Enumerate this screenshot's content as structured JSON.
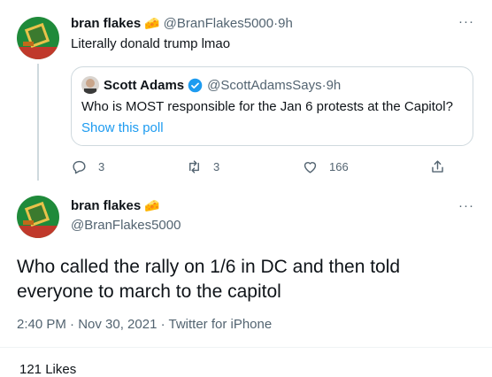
{
  "reply": {
    "author_name": "bran flakes",
    "author_emoji": "🧀",
    "handle": "@BranFlakes5000",
    "separator": " · ",
    "time": "9h",
    "text": "Literally donald trump lmao",
    "more": "···",
    "quote": {
      "author_name": "Scott Adams",
      "handle": "@ScottAdamsSays",
      "separator": " · ",
      "time": "9h",
      "text": "Who is MOST responsible for the Jan 6 protests at the Capitol?",
      "link": "Show this poll"
    },
    "actions": {
      "replies": "3",
      "retweets": "3",
      "likes": "166"
    }
  },
  "main": {
    "author_name": "bran flakes",
    "author_emoji": "🧀",
    "handle": "@BranFlakes5000",
    "more": "···",
    "text": "Who called the rally on 1/6 in DC and then told everyone to march to the capitol",
    "timestamp": "2:40 PM · Nov 30, 2021 · Twitter for iPhone",
    "likes_partial": "121 Likes"
  },
  "colors": {
    "accent": "#1d9bf0",
    "muted": "#536471",
    "border": "#cfd9de",
    "verified": "#1d9bf0"
  }
}
